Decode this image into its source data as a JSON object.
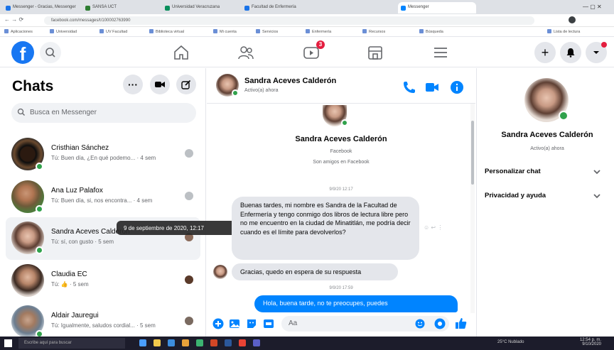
{
  "browser": {
    "tabs": [
      {
        "label": "Messenger - Gracias, Messenger"
      },
      {
        "label": "SANSA UCT"
      },
      {
        "label": "Universidad Veracruzana"
      },
      {
        "label": "Facultad de Enfermería"
      },
      {
        "label": "Messenger"
      }
    ],
    "url": "facebook.com/messages/t/100002763990"
  },
  "bookmarks": [
    "Aplicaciones",
    "Universidad",
    "UV Facultad",
    "Biblioteca virtual",
    "Mi cuenta",
    "Servicios",
    "Enfermería",
    "Recursos",
    "Búsqueda",
    "Lista de lectura"
  ],
  "header": {
    "notification_badge": "3"
  },
  "chats_panel": {
    "title": "Chats",
    "search_placeholder": "Busca en Messenger",
    "conversations": [
      {
        "name": "Cristhian Sánchez",
        "snippet": "Tú: Buen día, ¿En qué podemo...",
        "time": "· 4 sem"
      },
      {
        "name": "Ana Luz Palafox",
        "snippet": "Tú: Buen día, si, nos encontra...",
        "time": "· 4 sem"
      },
      {
        "name": "Sandra Aceves Calderón",
        "snippet": "Tú: sí, con gusto",
        "time": "· 5 sem"
      },
      {
        "name": "Claudia EC",
        "snippet": "Tú: 👍",
        "time": "· 5 sem"
      },
      {
        "name": "Aldair Jauregui",
        "snippet": "Tú: Igualmente, saludos cordial...",
        "time": "· 5 sem"
      }
    ],
    "tooltip": "9 de septiembre de 2020, 12:17"
  },
  "conversation": {
    "contact_name": "Sandra Aceves Calderón",
    "contact_status": "Activo(a) ahora",
    "profile_subtitle1": "Facebook",
    "profile_subtitle2": "Son amigos en Facebook",
    "timestamp1": "9/9/20 12:17",
    "message1": "Buenas tardes, mi nombre es Sandra de la Facultad de Enfermería y tengo conmigo dos libros de lectura libre pero no me encuentro en la ciudad de Minatitlán, me podría decir cuando es el límite para devolverlos?",
    "message2": "Gracias, quedo en espera de su respuesta",
    "timestamp2": "9/9/20 17:59",
    "message3": "Hola, buena tarde, no te preocupes, puedes",
    "composer_placeholder": "Aa"
  },
  "right_panel": {
    "name": "Sandra Aceves Calderón",
    "status": "Activo(a) ahora",
    "customize_label": "Personalizar chat",
    "privacy_label": "Privacidad y ayuda"
  },
  "taskbar": {
    "search_placeholder": "Escribe aquí para buscar",
    "weather": "25°C Nublado",
    "time": "12:54 p. m.",
    "date": "9/10/2020"
  },
  "colors": {
    "brand": "#1877f2",
    "messenger_blue": "#0084ff",
    "online": "#31a24c",
    "badge": "#e41e3f"
  }
}
